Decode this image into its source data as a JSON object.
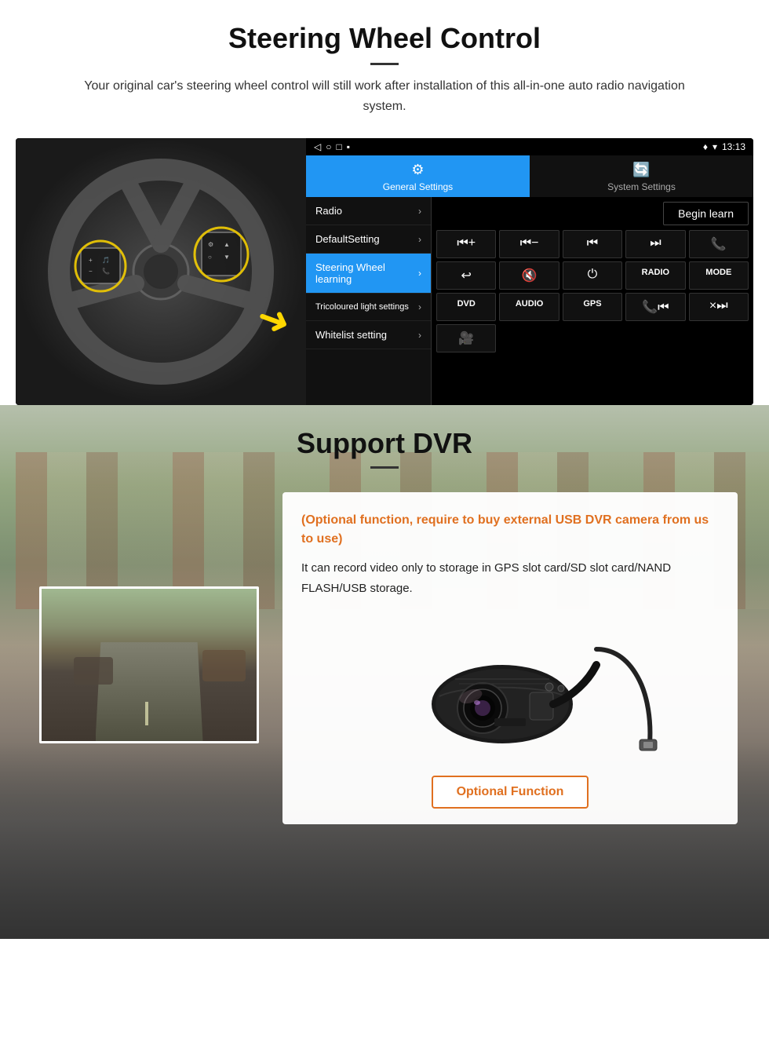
{
  "steering": {
    "title": "Steering Wheel Control",
    "subtitle": "Your original car's steering wheel control will still work after installation of this all-in-one auto radio navigation system.",
    "status_bar": {
      "signal": "▼",
      "wifi": "▾",
      "time": "13:13"
    },
    "nav_bar": {
      "back": "◁",
      "home": "○",
      "recents": "□",
      "menu": "▪"
    },
    "tabs": {
      "general": {
        "label": "General Settings",
        "icon": "⚙"
      },
      "system": {
        "label": "System Settings",
        "icon": "🔄"
      }
    },
    "menu_items": [
      {
        "label": "Radio",
        "active": false
      },
      {
        "label": "DefaultSetting",
        "active": false
      },
      {
        "label": "Steering Wheel learning",
        "active": true
      },
      {
        "label": "Tricoloured light settings",
        "active": false
      },
      {
        "label": "Whitelist setting",
        "active": false
      }
    ],
    "begin_learn": "Begin learn",
    "control_buttons": [
      {
        "label": "⏮+",
        "type": "icon"
      },
      {
        "label": "⏮−",
        "type": "icon"
      },
      {
        "label": "⏮⏮",
        "type": "icon"
      },
      {
        "label": "⏭⏭",
        "type": "icon"
      },
      {
        "label": "📞",
        "type": "icon"
      },
      {
        "label": "↩",
        "type": "icon"
      },
      {
        "label": "🔇×",
        "type": "icon"
      },
      {
        "label": "⏻",
        "type": "icon"
      },
      {
        "label": "RADIO",
        "type": "text"
      },
      {
        "label": "MODE",
        "type": "text"
      },
      {
        "label": "DVD",
        "type": "text"
      },
      {
        "label": "AUDIO",
        "type": "text"
      },
      {
        "label": "GPS",
        "type": "text"
      },
      {
        "label": "📞⏮",
        "type": "icon"
      },
      {
        "label": "×⏭",
        "type": "icon"
      },
      {
        "label": "📹",
        "type": "icon"
      }
    ]
  },
  "dvr": {
    "title": "Support DVR",
    "optional_text": "(Optional function, require to buy external USB DVR camera from us to use)",
    "description": "It can record video only to storage in GPS slot card/SD slot card/NAND FLASH/USB storage.",
    "optional_function_label": "Optional Function"
  }
}
